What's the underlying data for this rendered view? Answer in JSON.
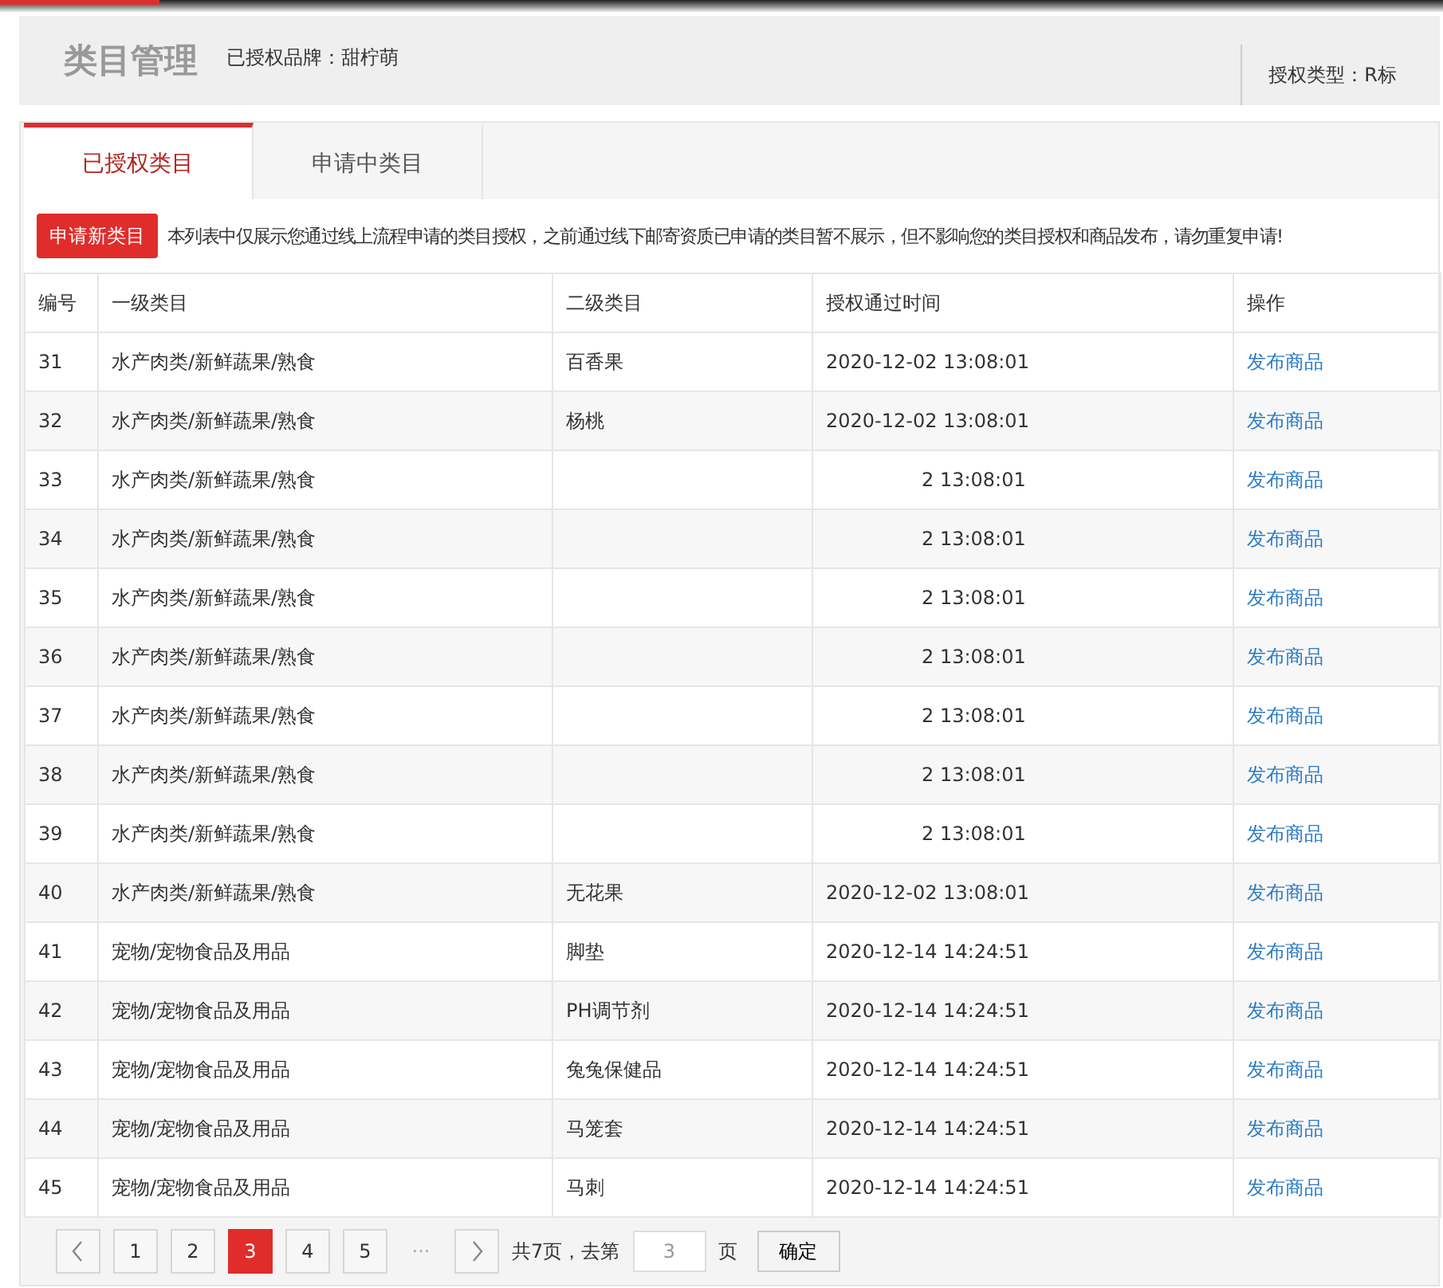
{
  "header": {
    "title": "类目管理",
    "brand": "已授权品牌：甜柠萌",
    "auth_type": "授权类型：R标"
  },
  "tabs": [
    {
      "label": "已授权类目",
      "selected": true
    },
    {
      "label": "申请中类目",
      "selected": false
    }
  ],
  "notice": {
    "button": "申请新类目",
    "text": "本列表中仅展示您通过线上流程申请的类目授权，之前通过线下邮寄资质已申请的类目暂不展示，但不影响您的类目授权和商品发布，请勿重复申请!"
  },
  "table": {
    "columns": [
      "编号",
      "一级类目",
      "二级类目",
      "授权通过时间",
      "操作"
    ],
    "rows": [
      {
        "kind": "full",
        "no": "31",
        "cat1": "水产肉类/新鲜蔬果/熟食",
        "cat2": "百香果",
        "time": "2020-12-02 13:08:01",
        "action": "发布商品"
      },
      {
        "kind": "full",
        "no": "32",
        "cat1": "水产肉类/新鲜蔬果/熟食",
        "cat2": "杨桃",
        "time": "2020-12-02 13:08:01",
        "action": "发布商品"
      },
      {
        "kind": "partial",
        "no": "33",
        "cat1": "水产肉类/新鲜蔬果/熟食",
        "time": "2 13:08:01",
        "action": "发布商品"
      },
      {
        "kind": "partial",
        "no": "34",
        "cat1": "水产肉类/新鲜蔬果/熟食",
        "time": "2 13:08:01",
        "action": "发布商品"
      },
      {
        "kind": "partial",
        "no": "35",
        "cat1": "水产肉类/新鲜蔬果/熟食",
        "time": "2 13:08:01",
        "action": "发布商品"
      },
      {
        "kind": "partial",
        "no": "36",
        "cat1": "水产肉类/新鲜蔬果/熟食",
        "time": "2 13:08:01",
        "action": "发布商品"
      },
      {
        "kind": "partial",
        "no": "37",
        "cat1": "水产肉类/新鲜蔬果/熟食",
        "time": "2 13:08:01",
        "action": "发布商品"
      },
      {
        "kind": "partial",
        "no": "38",
        "cat1": "水产肉类/新鲜蔬果/熟食",
        "time": "2 13:08:01",
        "action": "发布商品"
      },
      {
        "kind": "partial",
        "no": "39",
        "cat1": "水产肉类/新鲜蔬果/熟食",
        "time": "2 13:08:01",
        "action": "发布商品"
      },
      {
        "kind": "full",
        "no": "40",
        "cat1": "水产肉类/新鲜蔬果/熟食",
        "cat2": "无花果",
        "time": "2020-12-02 13:08:01",
        "action": "发布商品"
      },
      {
        "kind": "full",
        "no": "41",
        "cat1": "宠物/宠物食品及用品",
        "cat2": "脚垫",
        "time": "2020-12-14 14:24:51",
        "action": "发布商品"
      },
      {
        "kind": "full",
        "no": "42",
        "cat1": "宠物/宠物食品及用品",
        "cat2": "PH调节剂",
        "time": "2020-12-14 14:24:51",
        "action": "发布商品"
      },
      {
        "kind": "full",
        "no": "43",
        "cat1": "宠物/宠物食品及用品",
        "cat2": "兔兔保健品",
        "time": "2020-12-14 14:24:51",
        "action": "发布商品"
      },
      {
        "kind": "full",
        "no": "44",
        "cat1": "宠物/宠物食品及用品",
        "cat2": "马笼套",
        "time": "2020-12-14 14:24:51",
        "action": "发布商品"
      },
      {
        "kind": "full",
        "no": "45",
        "cat1": "宠物/宠物食品及用品",
        "cat2": "马刺",
        "time": "2020-12-14 14:24:51",
        "action": "发布商品"
      }
    ]
  },
  "pagination": {
    "pages": [
      {
        "label": "1",
        "selected": false
      },
      {
        "label": "2",
        "selected": false
      },
      {
        "label": "3",
        "selected": true
      },
      {
        "label": "4",
        "selected": false
      },
      {
        "label": "5",
        "selected": false
      }
    ],
    "ellipsis": "···",
    "total": "共7页，去第",
    "page_input": "3",
    "unit": "页",
    "confirm": "确定"
  }
}
